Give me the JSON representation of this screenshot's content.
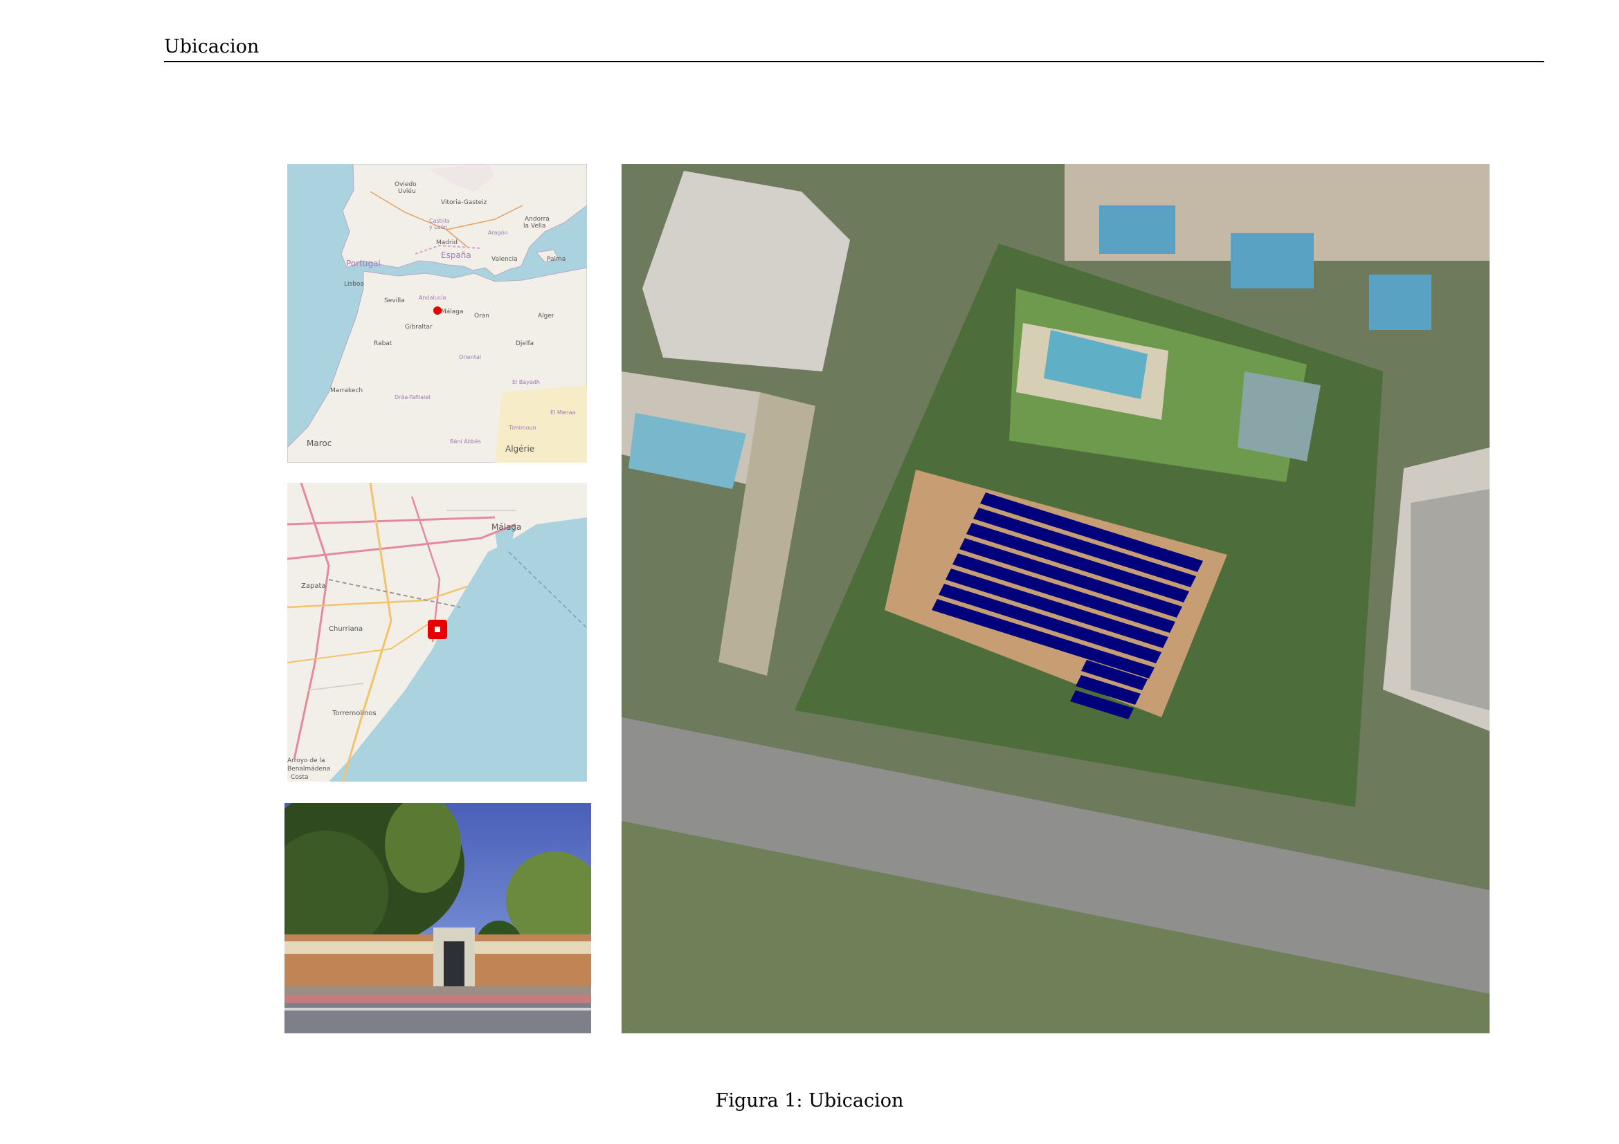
{
  "header": {
    "title": "Ubicacion"
  },
  "figure": {
    "caption": "Figura 1: Ubicacion"
  },
  "map_overview": {
    "labels": [
      "Oviedo / Uviéu",
      "Vitoria-Gasteiz",
      "Andorra la Vella",
      "Castilla y León",
      "Aragón",
      "Madrid",
      "Portugal",
      "España",
      "Valencia",
      "Palma",
      "Lisboa",
      "Andalucía",
      "Sevilla",
      "Málaga",
      "Gibraltar",
      "Oran",
      "Alger",
      "Rabat",
      "Djelfa",
      "Oriental",
      "Marrakech",
      "El Bayadh",
      "Drâa-Tafilalet",
      "El Menaa",
      "Timimoun",
      "Maroc",
      "Béni Abbès",
      "Algérie"
    ],
    "marker_color": "#e60000"
  },
  "map_city": {
    "labels": [
      "Málaga",
      "Zapata",
      "Churriana",
      "Torremolinos",
      "Arroyo de la Miel-Benalmádena Costa"
    ],
    "marker_color": "#e60000"
  },
  "aerial": {
    "panel_color": "#00007c",
    "panel_rows": 11
  }
}
